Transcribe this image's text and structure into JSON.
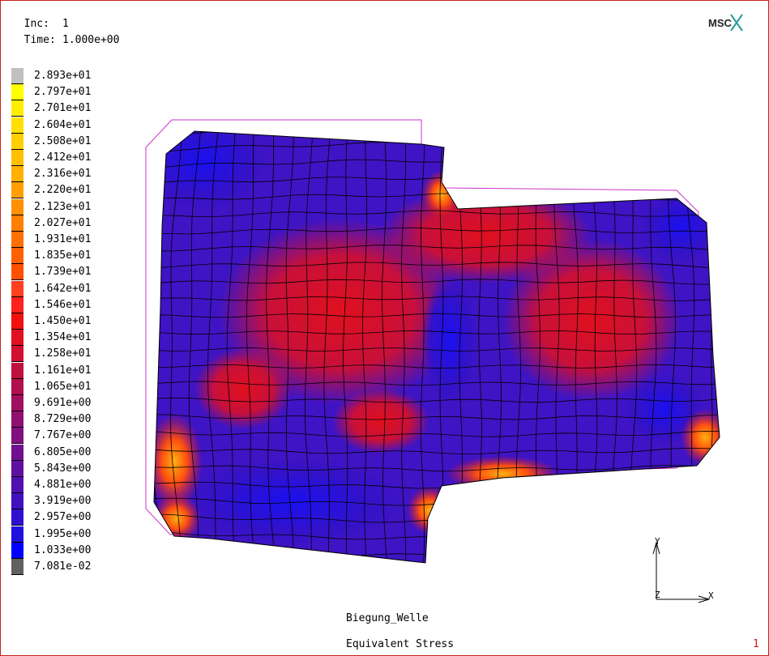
{
  "header": {
    "inc_label": "Inc:",
    "inc_value": "1",
    "time_label": "Time:",
    "time_value": "1.000e+00"
  },
  "logo_text": "MSC",
  "legend": {
    "labels": [
      "2.893e+01",
      "2.797e+01",
      "2.701e+01",
      "2.604e+01",
      "2.508e+01",
      "2.412e+01",
      "2.316e+01",
      "2.220e+01",
      "2.123e+01",
      "2.027e+01",
      "1.931e+01",
      "1.835e+01",
      "1.739e+01",
      "1.642e+01",
      "1.546e+01",
      "1.450e+01",
      "1.354e+01",
      "1.258e+01",
      "1.161e+01",
      "1.065e+01",
      "9.691e+00",
      "8.729e+00",
      "7.767e+00",
      "6.805e+00",
      "5.843e+00",
      "4.881e+00",
      "3.919e+00",
      "2.957e+00",
      "1.995e+00",
      "1.033e+00",
      "7.081e-02"
    ],
    "colors": [
      "#c0c0c0",
      "#ffff00",
      "#ffee00",
      "#ffe000",
      "#ffd000",
      "#ffc000",
      "#ffb000",
      "#ffa000",
      "#ff9000",
      "#ff8000",
      "#ff7000",
      "#ff6000",
      "#ff5000",
      "#ff4020",
      "#ff2020",
      "#f01010",
      "#e01020",
      "#d01030",
      "#c01040",
      "#b01050",
      "#a01060",
      "#901070",
      "#801080",
      "#701090",
      "#6010a0",
      "#5010b0",
      "#4010c0",
      "#3010d0",
      "#2010e0",
      "#0000ff",
      "#606060"
    ]
  },
  "triad": {
    "y_label": "Y",
    "z_label": "Z",
    "x_label": "X"
  },
  "footer": {
    "job_name": "Biegung_Welle",
    "result_label": "Equivalent Stress",
    "page_number": "1"
  },
  "colors": {
    "low": "#2814d8",
    "mid": "#b0104a",
    "high": "#e8101c",
    "peak": "#ff9010",
    "undeformed_outline": "#cc33cc",
    "frame": "#c82020"
  }
}
